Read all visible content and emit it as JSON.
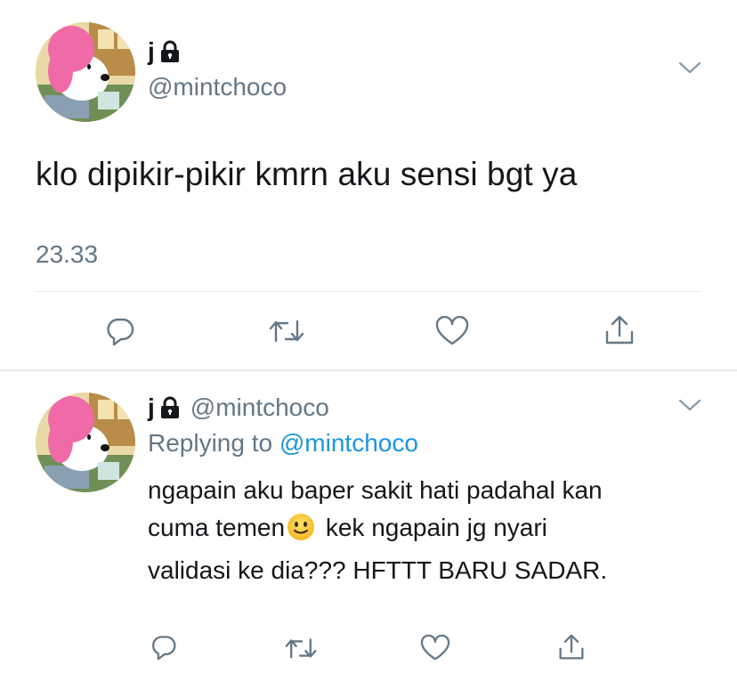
{
  "main_tweet": {
    "display_name": "j",
    "handle": "@mintchoco",
    "text": "klo dipikir-pikir kmrn aku sensi bgt ya",
    "time": "23.33",
    "icons": {
      "lock": "lock-icon",
      "more": "chevron-down-icon",
      "reply": "reply-icon",
      "retweet": "retweet-icon",
      "like": "heart-icon",
      "share": "share-icon"
    }
  },
  "reply_tweet": {
    "display_name": "j",
    "handle": "@mintchoco",
    "replying_to_label": "Replying to",
    "replying_to_handle": "@mintchoco",
    "text_line1": "ngapain aku baper sakit hati padahal kan",
    "text_line2_a": "cuma temen",
    "emoji": "slightly-smiling-face-emoji",
    "text_line2_b": " kek ngapain jg nyari",
    "text_line3": "validasi ke dia??? HFTTT BARU SADAR."
  },
  "colors": {
    "text": "#14171a",
    "secondary": "#657786",
    "link": "#1b95e0",
    "divider": "#e1e8ed"
  }
}
